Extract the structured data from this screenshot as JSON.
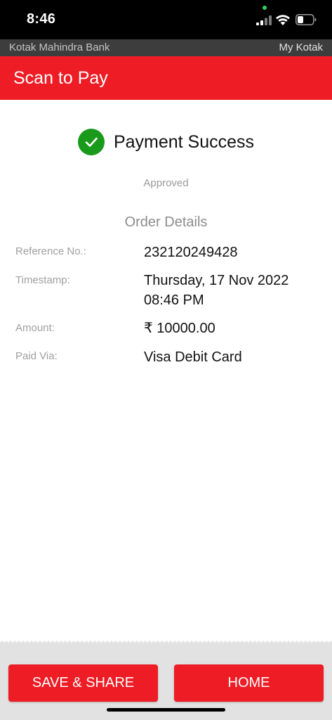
{
  "status_bar": {
    "time": "8:46",
    "icons": [
      "signal-icon",
      "wifi-icon",
      "battery-icon"
    ]
  },
  "brand_bar": {
    "bank_name": "Kotak Mahindra Bank",
    "link": "My Kotak"
  },
  "header": {
    "title": "Scan to Pay",
    "color": "#ee1c25"
  },
  "result": {
    "icon": "check-circle-icon",
    "icon_color": "#1a9a1a",
    "title": "Payment Success",
    "status": "Approved"
  },
  "order_details": {
    "title": "Order Details",
    "rows": [
      {
        "label": "Reference No.:",
        "value": "232120249428"
      },
      {
        "label": "Timestamp:",
        "value": "Thursday, 17 Nov 2022 08:46 PM"
      },
      {
        "label": "Amount:",
        "value": "₹ 10000.00"
      },
      {
        "label": "Paid Via:",
        "value": "Visa Debit Card"
      }
    ]
  },
  "footer": {
    "save_share_label": "SAVE & SHARE",
    "home_label": "HOME"
  }
}
